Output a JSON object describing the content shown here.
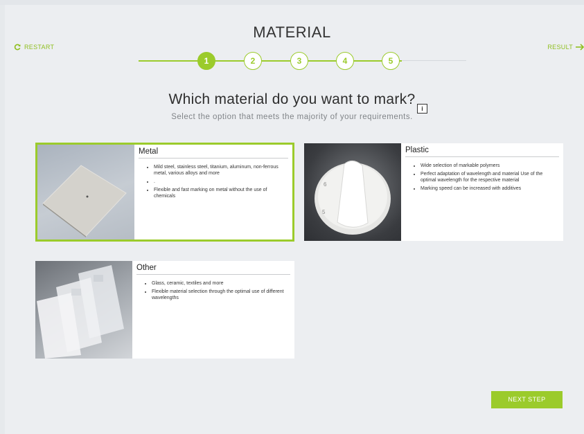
{
  "header": {
    "title": "MATERIAL",
    "restart_label": "RESTART",
    "result_label": "RESULT"
  },
  "stepper": {
    "steps": [
      "1",
      "2",
      "3",
      "4",
      "5"
    ],
    "active_step": 1
  },
  "question": {
    "title": "Which material do you want to mark?",
    "subtitle": "Select the option that meets the majority of your requirements.",
    "info_label": "i"
  },
  "options": [
    {
      "name": "Metal",
      "selected": true,
      "bullets": [
        "Mild steel, stainless steel, titanium, aluminum, non-ferrous metal, various alloys and more",
        ".",
        "Flexible and fast marking on metal without the use of chemicals"
      ]
    },
    {
      "name": "Plastic",
      "selected": false,
      "bullets": [
        "Wide selection of markable polymers",
        "Perfect adaptation of wavelength and material Use of the optimal wavelength for the respective material",
        "Marking speed can be increased with additives"
      ]
    },
    {
      "name": "Other",
      "selected": false,
      "bullets": [
        "Glass, ceramic, textiles and more",
        "Flexible material selection through the optimal use of different wavelengths"
      ]
    }
  ],
  "footer": {
    "next_label": "NEXT STEP"
  },
  "colors": {
    "accent": "#9bcb2b",
    "background": "#eceef1"
  },
  "icons": {
    "restart": "refresh-icon",
    "result": "arrow-right-icon"
  }
}
